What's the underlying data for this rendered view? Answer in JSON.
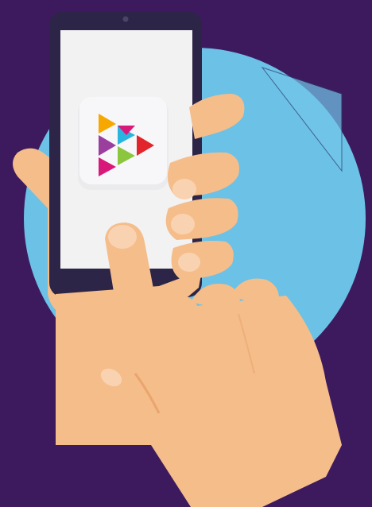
{
  "illustration": {
    "subject": "",
    "colors": {
      "background": "#3d1a5e",
      "circle": "#6cc1e6",
      "circle_outline": "#2a3a6a",
      "phone_body": "#2c2547",
      "phone_screen": "#f2f2f2",
      "skin": "#f5bd8a",
      "skin_shadow": "#e9a56d",
      "nail": "#f9d3b1",
      "app_icon_bg": "#f7f7f9"
    },
    "app_icon": {
      "name": "play-logo-icon",
      "triangles": [
        {
          "color": "#f6a800"
        },
        {
          "color": "#d9197a"
        },
        {
          "color": "#9b3f9f"
        },
        {
          "color": "#28b5e0"
        },
        {
          "color": "#d9197a"
        },
        {
          "color": "#8cc63f"
        },
        {
          "color": "#e2242b"
        }
      ]
    }
  }
}
